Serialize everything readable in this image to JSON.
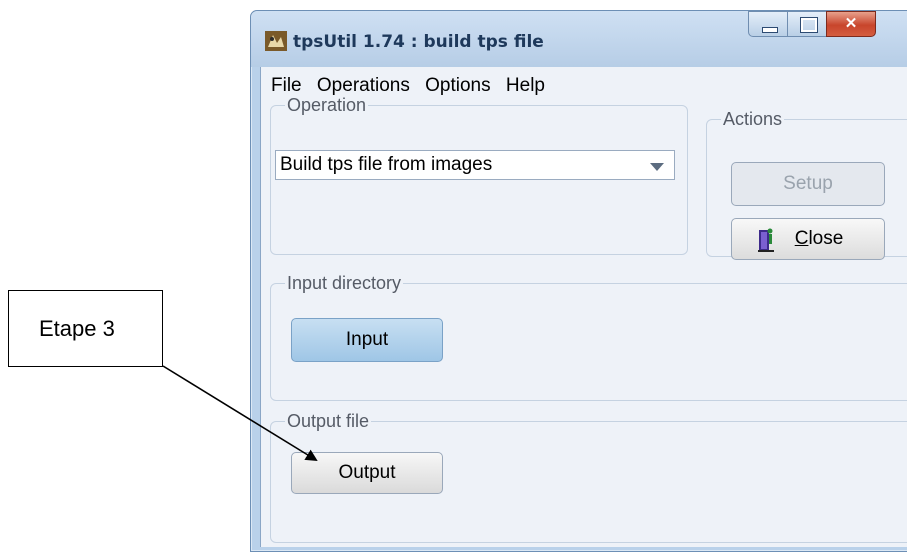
{
  "window": {
    "title": "tpsUtil 1.74 : build tps file",
    "close_glyph": "✕"
  },
  "menu": [
    "File",
    "Operations",
    "Options",
    "Help"
  ],
  "operation": {
    "legend": "Operation",
    "selected": "Build tps file from images"
  },
  "actions": {
    "legend": "Actions",
    "setup_label": "Setup",
    "close_label": "Close"
  },
  "input": {
    "legend": "Input directory",
    "button_label": "Input"
  },
  "output": {
    "legend": "Output file",
    "button_label": "Output"
  },
  "annotation": {
    "label": "Etape 3"
  },
  "colors": {
    "title_bar": "#b9d1ea",
    "client_bg": "#eef2f8",
    "input_button": "#9fc6e6",
    "close_button": "#c8452c"
  },
  "icons": [
    "app-icon",
    "minimize-icon",
    "maximize-icon",
    "close-icon",
    "dropdown-caret-icon",
    "door-exit-icon",
    "arrow-annotation"
  ]
}
